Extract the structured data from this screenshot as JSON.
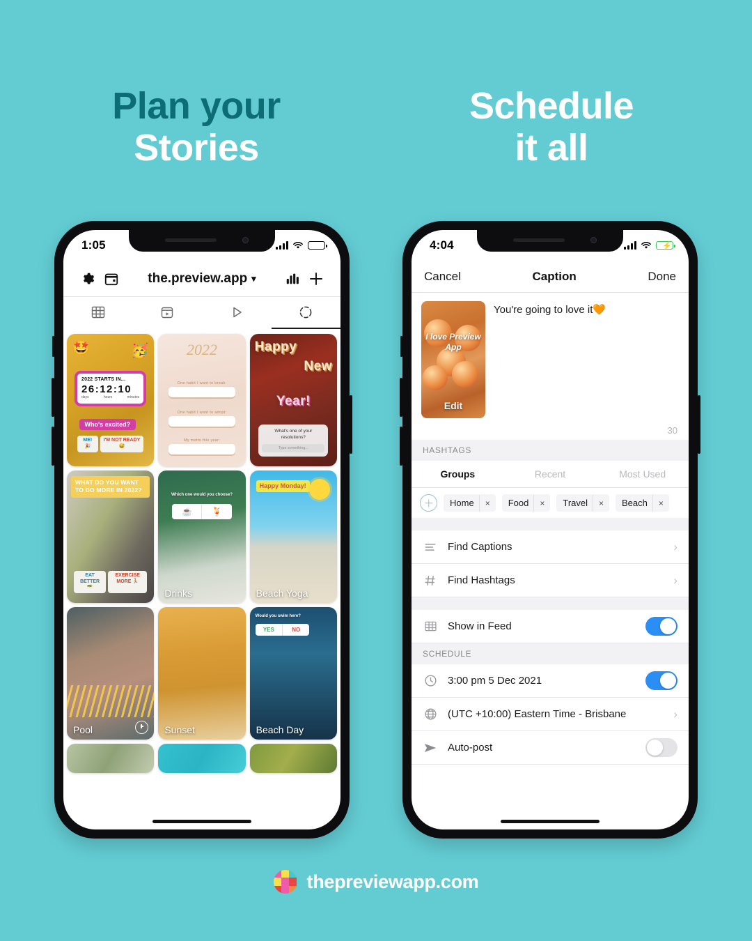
{
  "background_color": "#63ccd3",
  "headlines": {
    "left": {
      "line1": "Plan your",
      "line2": "Stories"
    },
    "right": {
      "line1": "Schedule",
      "line2": "it all"
    }
  },
  "left_phone": {
    "status": {
      "time": "1:05",
      "signal_icon": "cellular-signal-icon",
      "wifi_icon": "wifi-icon",
      "battery_icon": "battery-icon"
    },
    "topbar": {
      "settings_icon": "gear-icon",
      "calendar_icon": "calendar-icon",
      "username": "the.preview.app",
      "chevron": "⌄",
      "analytics_icon": "bar-chart-icon",
      "add_icon": "plus-icon"
    },
    "tabs": [
      {
        "name": "grid-tab",
        "icon": "grid-icon",
        "active": false
      },
      {
        "name": "reels-tab",
        "icon": "reels-icon",
        "active": false
      },
      {
        "name": "video-tab",
        "icon": "play-icon",
        "active": false
      },
      {
        "name": "stories-tab",
        "icon": "stories-circle-icon",
        "active": true
      }
    ],
    "stories": [
      {
        "name": "story-2022-countdown",
        "caption": "",
        "overlays": {
          "emoji_left": "🤩",
          "emoji_right": "🥳",
          "countdown_title": "2022 STARTS IN...",
          "countdown_digits": "26:12:10",
          "unit_days": "days",
          "unit_hours": "hours",
          "unit_minutes": "minutes",
          "question": "Who's excited?",
          "answer_1": "ME! 🎉",
          "answer_2": "I'M NOT READY 😅"
        }
      },
      {
        "name": "story-2022-prompts",
        "caption": "",
        "overlays": {
          "year": "2022",
          "prompt_1": "One habit I want to break:",
          "prompt_2": "One habit I want to adopt:",
          "prompt_3": "My motto this year:"
        }
      },
      {
        "name": "story-happy-new-year",
        "caption": "",
        "overlays": {
          "word_1": "Happy",
          "word_2": "New",
          "word_3": "Year!",
          "question": "What's one of your resolutions?",
          "input_placeholder": "Type something..."
        }
      },
      {
        "name": "story-do-more-2022",
        "caption": "",
        "overlays": {
          "banner": "WHAT DO YOU WANT TO DO MORE IN 2022?",
          "answer_1": "EAT BETTER 🥗",
          "answer_2": "EXERCISE MORE 🏃"
        }
      },
      {
        "name": "story-drinks",
        "caption": "Drinks",
        "overlays": {
          "question": "Which one would you choose?",
          "choice_1": "☕",
          "choice_2": "🍹"
        }
      },
      {
        "name": "story-beach-yoga",
        "caption": "Beach Yoga",
        "overlays": {
          "sticker": "Happy Monday!",
          "sun": "sun-icon"
        }
      },
      {
        "name": "story-pool",
        "caption": "Pool",
        "overlays": {
          "scheduled_badge": "clock-icon"
        }
      },
      {
        "name": "story-sunset",
        "caption": "Sunset",
        "overlays": {}
      },
      {
        "name": "story-beach-day",
        "caption": "Beach Day",
        "overlays": {
          "question": "Would you swim here?",
          "answer_yes": "YES",
          "answer_no": "NO"
        }
      },
      {
        "name": "story-plants",
        "caption": "",
        "overlays": {}
      },
      {
        "name": "story-water",
        "caption": "",
        "overlays": {}
      },
      {
        "name": "story-palm",
        "caption": "",
        "overlays": {}
      }
    ]
  },
  "right_phone": {
    "status": {
      "time": "4:04",
      "signal_icon": "cellular-signal-icon",
      "wifi_icon": "wifi-icon",
      "battery_icon": "battery-charging-icon"
    },
    "nav": {
      "cancel": "Cancel",
      "title": "Caption",
      "done": "Done"
    },
    "post": {
      "thumbnail_text": "I love Preview App",
      "edit_label": "Edit",
      "caption": "You're going to love it🧡",
      "char_counter": "30"
    },
    "hashtags": {
      "section_label": "HASHTAGS",
      "tabs": [
        {
          "label": "Groups",
          "active": true
        },
        {
          "label": "Recent",
          "active": false
        },
        {
          "label": "Most Used",
          "active": false
        }
      ],
      "add_icon": "plus-circle-icon",
      "chips": [
        {
          "label": "Home",
          "remove": "×"
        },
        {
          "label": "Food",
          "remove": "×"
        },
        {
          "label": "Travel",
          "remove": "×"
        },
        {
          "label": "Beach",
          "remove": "×"
        }
      ]
    },
    "actions": [
      {
        "name": "find-captions-row",
        "icon": "lines-icon",
        "label": "Find Captions",
        "chevron": "›"
      },
      {
        "name": "find-hashtags-row",
        "icon": "hash-icon",
        "label": "Find Hashtags",
        "chevron": "›"
      }
    ],
    "feed": {
      "icon": "grid-icon",
      "label": "Show in Feed",
      "toggle_on": true
    },
    "schedule": {
      "section_label": "SCHEDULE",
      "time_row": {
        "icon": "clock-icon",
        "label": "3:00 pm  5 Dec 2021",
        "toggle_on": true
      },
      "timezone_row": {
        "icon": "globe-icon",
        "label": "(UTC +10:00) Eastern Time - Brisbane",
        "chevron": "›"
      },
      "autopost_row": {
        "icon": "send-icon",
        "label": "Auto-post",
        "toggle_on": false
      }
    }
  },
  "footer": {
    "logo_icon": "preview-app-logo-icon",
    "text": "thepreviewapp.com"
  }
}
